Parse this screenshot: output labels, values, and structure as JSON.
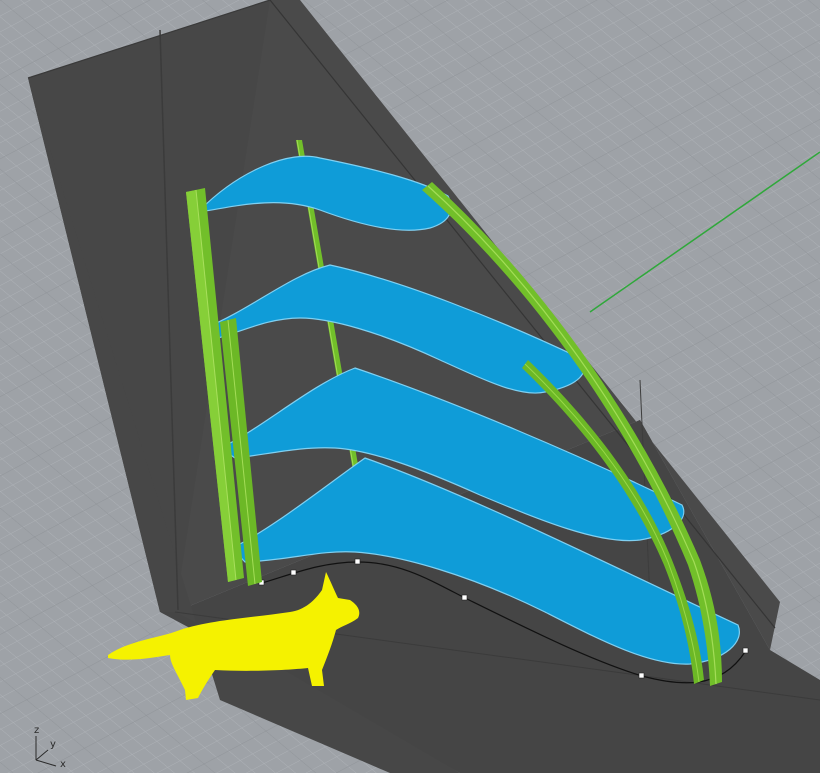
{
  "viewport": {
    "axis_labels": {
      "z": "z",
      "y": "y",
      "x": "x"
    }
  },
  "colors": {
    "background": "#9ea2a7",
    "grid_minor": "#a9adb2",
    "grid_major": "#8b8f94",
    "wall_floor": "#474747",
    "wall_edge": "#3a3a3a",
    "shelf": "#0f9cd8",
    "shelf_edge": "#8fd8f5",
    "frame": "#72bf2a",
    "frame_highlight": "#9ad84a",
    "silhouette": "#f5f200",
    "world_axis": "#2fa83a"
  },
  "objects": [
    "wall-corner-geometry",
    "shelf-1",
    "shelf-2",
    "shelf-3",
    "shelf-4",
    "front-post-left",
    "front-post-left-inner",
    "center-rod",
    "curved-side-rail-outer",
    "curved-side-rail-inner",
    "floor-control-curve",
    "dog-silhouette"
  ]
}
